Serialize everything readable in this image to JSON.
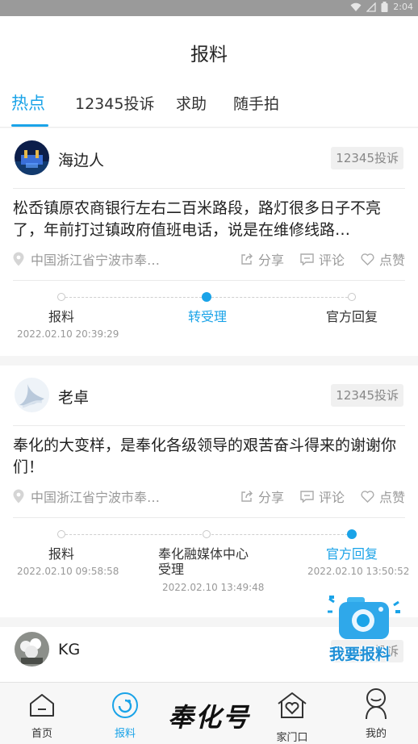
{
  "status_bar": {
    "time": "2:04"
  },
  "header": {
    "title": "报料"
  },
  "tabs": [
    {
      "label": "热点",
      "active": true
    },
    {
      "label": "12345投诉",
      "active": false
    },
    {
      "label": "求助",
      "active": false
    },
    {
      "label": "随手拍",
      "active": false
    }
  ],
  "posts": [
    {
      "username": "海边人",
      "category": "12345投诉",
      "content": "松岙镇原农商银行左右二百米路段，路灯很多日子不亮了，年前打过镇政府值班电话，说是在维修线路…",
      "location": "中国浙江省宁波市奉…",
      "actions": {
        "share": "分享",
        "comment": "评论",
        "like": "点赞"
      },
      "steps": [
        {
          "label": "报料",
          "time": "2022.02.10 20:39:29",
          "active": false
        },
        {
          "label": "转受理",
          "time": "",
          "active": true
        },
        {
          "label": "官方回复",
          "time": "",
          "active": false
        }
      ]
    },
    {
      "username": "老卓",
      "category": "12345投诉",
      "content": "奉化的大变样，是奉化各级领导的艰苦奋斗得来的谢谢你们！",
      "location": "中国浙江省宁波市奉…",
      "actions": {
        "share": "分享",
        "comment": "评论",
        "like": "点赞"
      },
      "steps": [
        {
          "label": "报料",
          "time": "2022.02.10 09:58:58",
          "active": false
        },
        {
          "label": "奉化融媒体中心受理",
          "time": "2022.02.10 13:49:48",
          "active": false
        },
        {
          "label": "官方回复",
          "time": "2022.02.10 13:50:52",
          "active": true
        }
      ]
    },
    {
      "username": "KG",
      "category": "12345投诉"
    }
  ],
  "float_button": {
    "label": "我要报料"
  },
  "bottom_nav": [
    {
      "label": "首页",
      "icon": "home-icon",
      "active": false
    },
    {
      "label": "报料",
      "icon": "report-icon",
      "active": true
    },
    {
      "logo_text": "奉化号"
    },
    {
      "label": "家门口",
      "icon": "house-heart-icon",
      "active": false
    },
    {
      "label": "我的",
      "icon": "profile-icon",
      "active": false
    }
  ],
  "colors": {
    "accent": "#1aa3e8",
    "status_bar": "#9a9a9a"
  }
}
